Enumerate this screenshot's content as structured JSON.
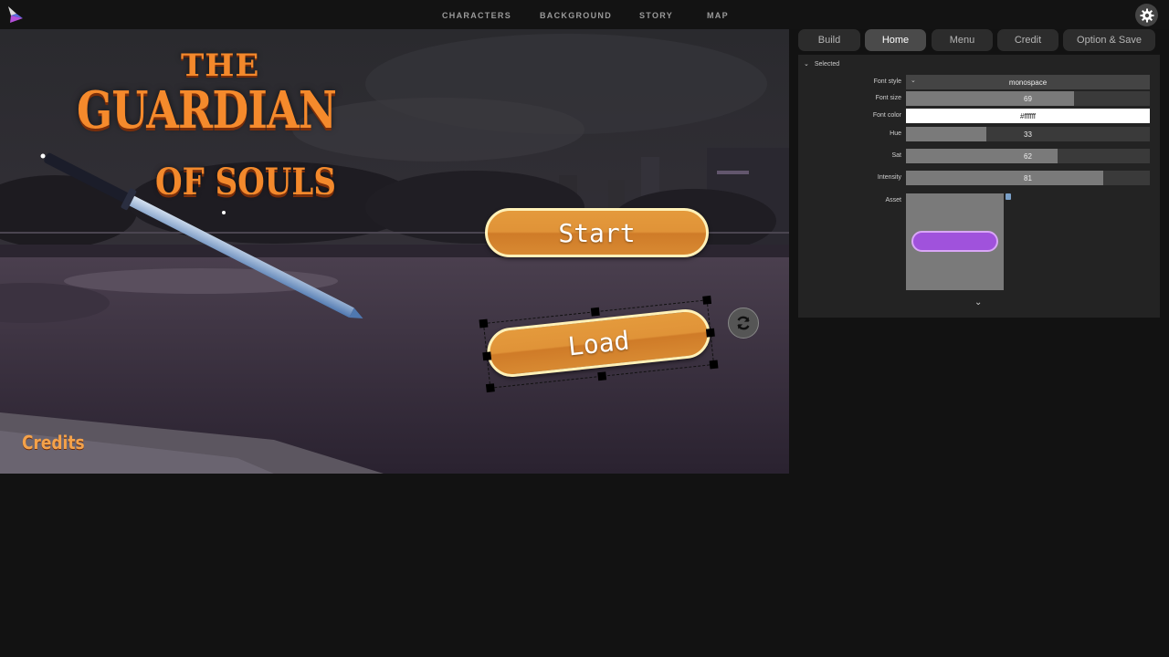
{
  "topnav": {
    "items": [
      "CHARACTERS",
      "BACKGROUND",
      "STORY",
      "MAP"
    ]
  },
  "game": {
    "title_line1": "THE",
    "title_line2": "GUARDIAN",
    "title_line3": "OF SOULS",
    "start_label": "Start",
    "load_label": "Load",
    "credits_label": "Credits",
    "button_color": "#e09338",
    "button_border": "#fff1b8"
  },
  "panel": {
    "tabs": [
      "Build",
      "Home",
      "Menu",
      "Credit",
      "Option & Save"
    ],
    "active_tab": "Home",
    "section": "Selected",
    "font_style_label": "Font style",
    "font_style_value": "monospace",
    "font_size_label": "Font size",
    "font_size_value": "69",
    "font_color_label": "Font color",
    "font_color_value": "#ffffff",
    "hue_label": "Hue",
    "hue_value": "33",
    "sat_label": "Sat",
    "sat_value": "62",
    "intensity_label": "Intensity",
    "intensity_value": "81",
    "asset_label": "Asset",
    "asset_color": "#a052dc"
  },
  "icons": {
    "logo": "app-logo-icon",
    "settings": "gear-icon",
    "rotate": "rotate-icon",
    "collapse": "chevron-down-icon",
    "expand": "chevron-down-icon",
    "asset_upload": "file-icon"
  }
}
